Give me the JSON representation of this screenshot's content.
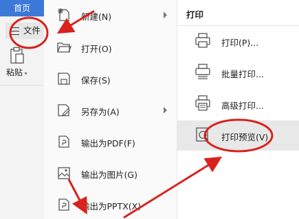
{
  "toolbar": {
    "home_tab": "首页",
    "file_button": "文件",
    "paste_label": "粘贴"
  },
  "menu": {
    "items": [
      {
        "label": "新建(N)",
        "icon": "new-file-icon",
        "has_submenu": true
      },
      {
        "label": "打开(O)",
        "icon": "folder-open-icon",
        "has_submenu": false
      },
      {
        "label": "保存(S)",
        "icon": "save-icon",
        "has_submenu": false
      },
      {
        "label": "另存为(A)",
        "icon": "save-as-icon",
        "has_submenu": true
      },
      {
        "label": "输出为PDF(F)",
        "icon": "pdf-export-icon",
        "has_submenu": false
      },
      {
        "label": "输出为图片(G)",
        "icon": "image-export-icon",
        "has_submenu": false
      },
      {
        "label": "输出为PPTX(X)",
        "icon": "pptx-export-icon",
        "has_submenu": false
      }
    ]
  },
  "submenu": {
    "title": "打印",
    "items": [
      {
        "label": "打印(P)...",
        "icon": "printer-icon"
      },
      {
        "label": "批量打印...",
        "icon": "batch-print-icon"
      },
      {
        "label": "高级打印...",
        "icon": "advanced-print-icon"
      },
      {
        "label": "打印预览(V)",
        "icon": "print-preview-icon",
        "highlighted": true
      }
    ]
  },
  "colors": {
    "accent": "#3c78d8",
    "annotation_red": "#d9221c",
    "highlight_bg": "#e8e8e8"
  }
}
